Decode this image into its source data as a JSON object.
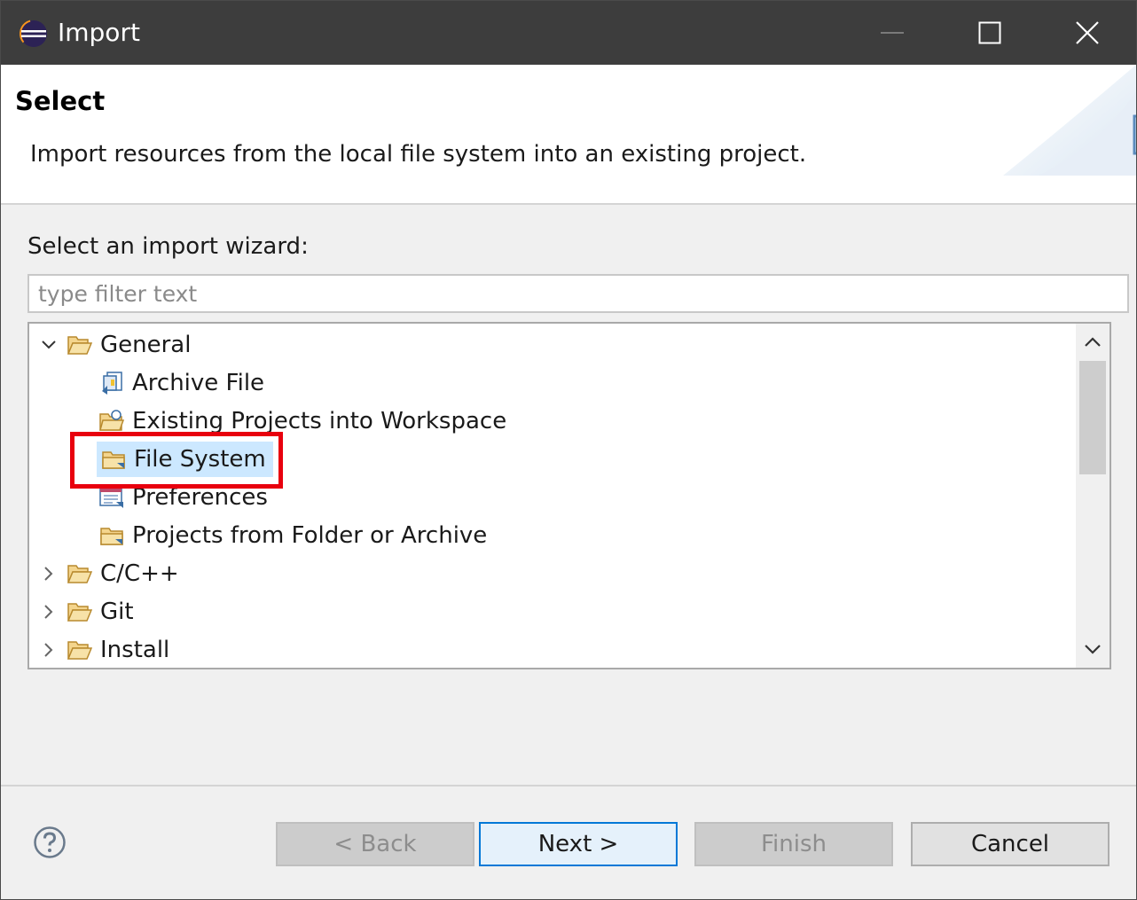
{
  "window": {
    "title": "Import",
    "controls": [
      "minimize",
      "maximize",
      "close"
    ]
  },
  "header": {
    "title": "Select",
    "description": "Import resources from the local file system into an existing project.",
    "banner_icon": "import-tray-icon"
  },
  "wizard": {
    "label": "Select an import wizard:",
    "filter_placeholder": "type filter text",
    "filter_value": "",
    "tree": {
      "general": "General",
      "archive_file": "Archive File",
      "existing_projects": "Existing Projects into Workspace",
      "file_system": "File System",
      "preferences": "Preferences",
      "projects_from_folder": "Projects from Folder or Archive",
      "cpp": "C/C++",
      "git": "Git",
      "install": "Install"
    },
    "selected_item": "File System"
  },
  "buttons": {
    "back": "< Back",
    "next": "Next >",
    "finish": "Finish",
    "cancel": "Cancel"
  },
  "colors": {
    "titlebar": "#3d3d3d",
    "selection": "#cce8ff",
    "highlight_box": "#e8000e",
    "default_button_border": "#0078d7"
  }
}
